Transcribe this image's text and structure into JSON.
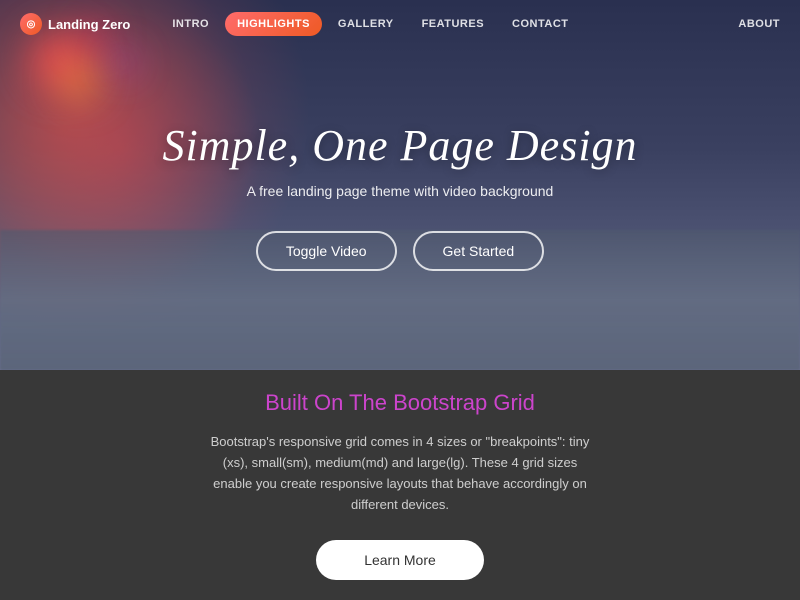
{
  "nav": {
    "brand": {
      "label": "Landing Zero",
      "icon_symbol": "◎"
    },
    "links": [
      {
        "id": "intro",
        "label": "INTRO",
        "active": false
      },
      {
        "id": "highlights",
        "label": "HIGHLIGHTS",
        "active": true
      },
      {
        "id": "gallery",
        "label": "GALLERY",
        "active": false
      },
      {
        "id": "features",
        "label": "FEATURES",
        "active": false
      },
      {
        "id": "contact",
        "label": "CONTACT",
        "active": false
      }
    ],
    "about_label": "ABOUT"
  },
  "hero": {
    "title": "Simple, One Page Design",
    "subtitle": "A free landing page theme with video background",
    "button_toggle": "Toggle Video",
    "button_start": "Get Started"
  },
  "section": {
    "title": "Built On The Bootstrap Grid",
    "description": "Bootstrap's responsive grid comes in 4 sizes or \"breakpoints\": tiny (xs), small(sm), medium(md) and large(lg). These 4 grid sizes enable you create responsive layouts that behave accordingly on different devices.",
    "button_learn_more": "Learn More"
  },
  "colors": {
    "accent_pink": "#cc44cc",
    "nav_active_gradient_start": "#ff6b6b",
    "nav_active_gradient_end": "#ee5a24"
  }
}
